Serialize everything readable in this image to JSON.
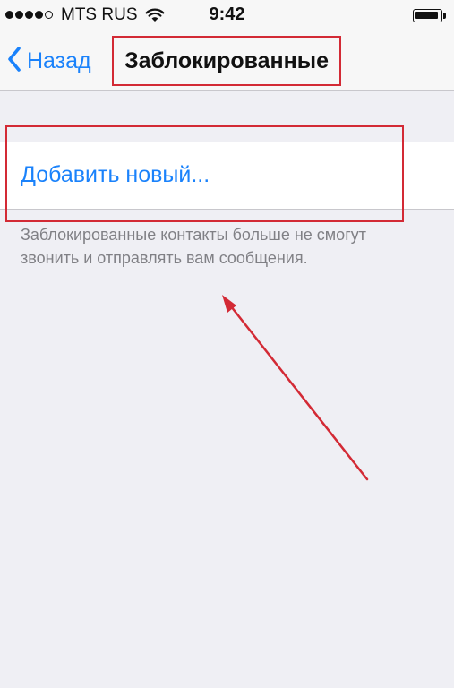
{
  "status_bar": {
    "carrier": "MTS RUS",
    "time": "9:42",
    "signal_bars_filled": 4,
    "signal_bars_total": 5,
    "battery_level": 0.95
  },
  "nav": {
    "back_label": "Назад",
    "title": "Заблокированные"
  },
  "content": {
    "add_new_label": "Добавить новый...",
    "footer_note": "Заблокированные контакты больше не смогут звонить и отправлять вам сообщения."
  },
  "colors": {
    "accent": "#1a82fb",
    "annotation": "#d32a35",
    "background": "#efeff4",
    "footer_text": "#808085"
  },
  "icons": {
    "back": "chevron-left-icon",
    "wifi": "wifi-icon",
    "battery": "battery-icon",
    "arrow": "annotation-arrow"
  }
}
